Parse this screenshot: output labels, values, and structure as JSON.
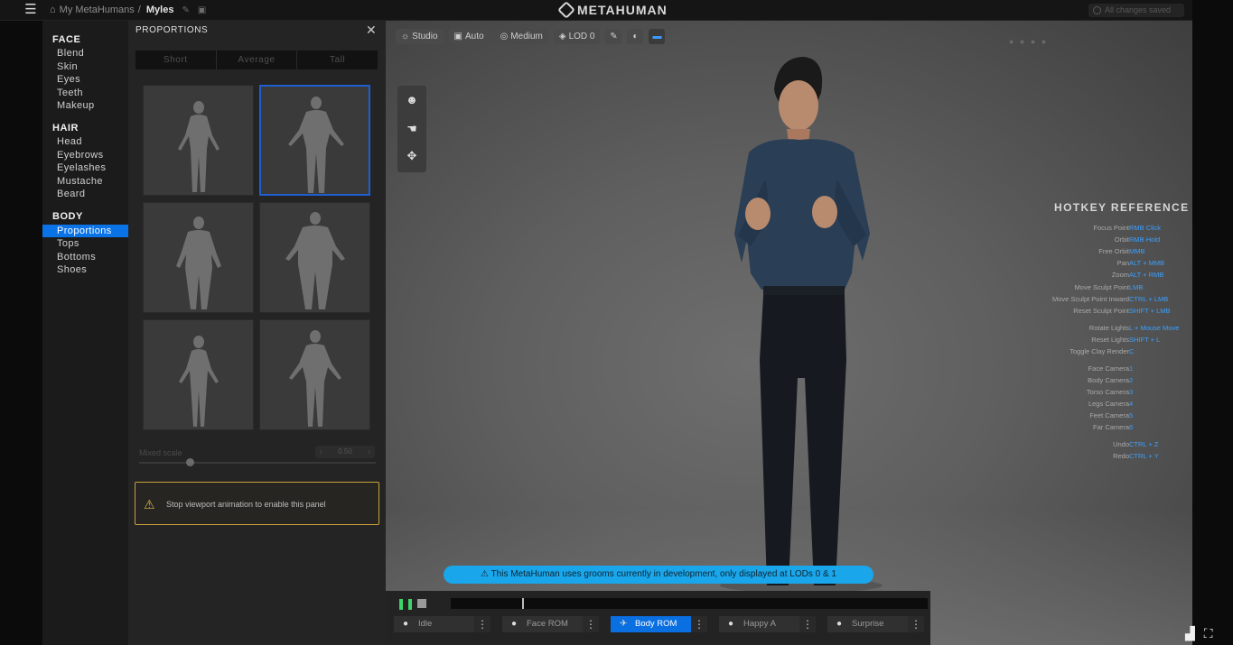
{
  "header": {
    "breadcrumb_root": "My MetaHumans",
    "breadcrumb_sep": "/",
    "breadcrumb_current": "Myles",
    "logo_text": "METAHUMAN",
    "auto_save_label": "All changes saved"
  },
  "nav": {
    "sections": [
      {
        "title": "FACE",
        "items": [
          "Blend",
          "Skin",
          "Eyes",
          "Teeth",
          "Makeup"
        ]
      },
      {
        "title": "HAIR",
        "items": [
          "Head",
          "Eyebrows",
          "Eyelashes",
          "Mustache",
          "Beard"
        ]
      },
      {
        "title": "BODY",
        "items": [
          "Proportions",
          "Tops",
          "Bottoms",
          "Shoes"
        ]
      }
    ],
    "active_item": "Proportions"
  },
  "panel": {
    "title": "PROPORTIONS",
    "close_glyph": "✕",
    "height_tabs": [
      "Short",
      "Average",
      "Tall"
    ],
    "blend_label": "Mixed scale",
    "blend_stepper_value": "0.50",
    "warning_text": "Stop viewport animation to enable this panel"
  },
  "viewport": {
    "toolbar": [
      {
        "icon": "bulb-icon",
        "label": "Studio"
      },
      {
        "icon": "camera-icon",
        "label": "Auto"
      },
      {
        "icon": "quality-icon",
        "label": "Medium"
      },
      {
        "icon": "lod-icon",
        "label": "LOD 0"
      }
    ],
    "right_faint": "● ●  ●  ●",
    "hotkeys": {
      "title": "HOTKEY REFERENCE",
      "rows": [
        {
          "k": "Focus Point",
          "v": "RMB Click"
        },
        {
          "k": "Orbit",
          "v": "RMB Hold"
        },
        {
          "k": "Free Orbit",
          "v": "MMB"
        },
        {
          "k": "Pan",
          "v": "ALT + MMB"
        },
        {
          "k": "Zoom",
          "v": "ALT + RMB"
        },
        {
          "k": "Move Sculpt Point",
          "v": "LMB"
        },
        {
          "k": "Move Sculpt Point Inward",
          "v": "CTRL + LMB"
        },
        {
          "k": "Reset Sculpt Point",
          "v": "SHIFT + LMB"
        },
        {
          "k": "Rotate Lights",
          "v": "L + Mouse Move"
        },
        {
          "k": "Reset Lights",
          "v": "SHIFT + L"
        },
        {
          "k": "Toggle Clay Render",
          "v": "C"
        },
        {
          "k": "Face Camera",
          "v": "1"
        },
        {
          "k": "Body Camera",
          "v": "2"
        },
        {
          "k": "Torso Camera",
          "v": "3"
        },
        {
          "k": "Legs Camera",
          "v": "4"
        },
        {
          "k": "Feet Camera",
          "v": "5"
        },
        {
          "k": "Far Camera",
          "v": "6"
        },
        {
          "k": "Undo",
          "v": "CTRL + Z"
        },
        {
          "k": "Redo",
          "v": "CTRL + Y"
        }
      ]
    },
    "grooms_notice": "⚠ This MetaHuman uses grooms currently in development, only displayed at LODs 0 & 1",
    "animations": [
      {
        "label": "Idle",
        "icon": "●"
      },
      {
        "label": "Face ROM",
        "icon": "●"
      },
      {
        "label": "Body ROM",
        "icon": "✈"
      },
      {
        "label": "Happy A",
        "icon": "●"
      },
      {
        "label": "Surprise",
        "icon": "●"
      }
    ],
    "active_animation": "Body ROM",
    "playback_progress": 0.15
  },
  "colors": {
    "accent": "#0a73e8",
    "warning": "#c9a13b",
    "notice": "#1aa6ea",
    "play": "#3ed46b"
  }
}
